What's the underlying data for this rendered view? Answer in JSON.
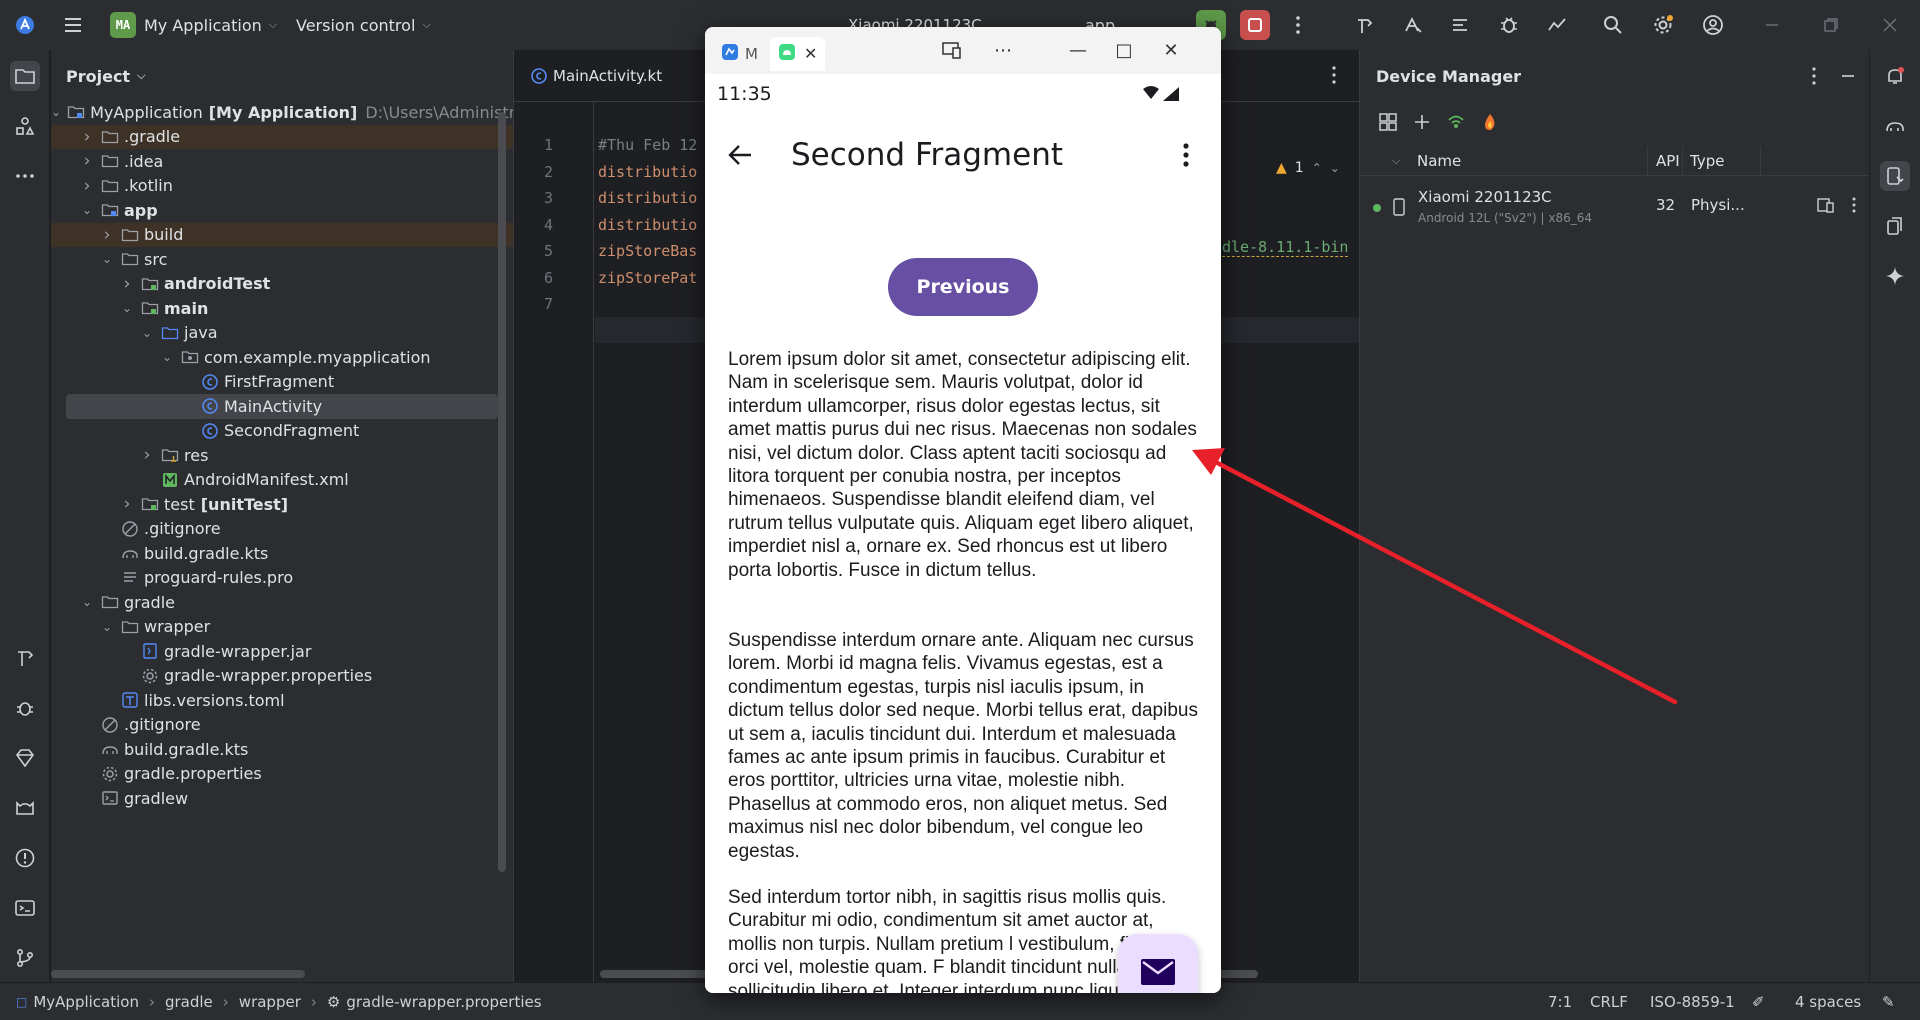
{
  "titlebar": {
    "project_badge": "MA",
    "project_name": "My Application",
    "version_control": "Version control",
    "device_selector": "Xiaomi 2201123C",
    "run_config": "app"
  },
  "project_panel": {
    "title": "Project",
    "tree": [
      {
        "label": "MyApplication",
        "suffix": "[My Application]",
        "path": "D:\\Users\\Administrat",
        "icon": "module-folder-icon",
        "chev": "down",
        "depth": 0
      },
      {
        "label": ".gradle",
        "icon": "folder-icon",
        "chev": "right",
        "depth": 1,
        "orange": true
      },
      {
        "label": ".idea",
        "icon": "folder-icon",
        "chev": "right",
        "depth": 1
      },
      {
        "label": ".kotlin",
        "icon": "folder-icon",
        "chev": "right",
        "depth": 1
      },
      {
        "label": "app",
        "icon": "module-folder-icon",
        "chev": "down",
        "depth": 1,
        "bold": true
      },
      {
        "label": "build",
        "icon": "folder-icon",
        "chev": "right",
        "depth": 2,
        "orange": true
      },
      {
        "label": "src",
        "icon": "folder-icon",
        "chev": "down",
        "depth": 2
      },
      {
        "label": "androidTest",
        "icon": "test-folder-icon",
        "chev": "right",
        "depth": 3,
        "bold": true
      },
      {
        "label": "main",
        "icon": "source-folder-icon",
        "chev": "down",
        "depth": 3,
        "bold": true
      },
      {
        "label": "java",
        "icon": "java-folder-icon",
        "chev": "down",
        "depth": 4
      },
      {
        "label": "com.example.myapplication",
        "icon": "package-icon",
        "chev": "down",
        "depth": 5
      },
      {
        "label": "FirstFragment",
        "icon": "kotlin-class-icon",
        "chev": "",
        "depth": 6
      },
      {
        "label": "MainActivity",
        "icon": "kotlin-class-icon",
        "chev": "",
        "depth": 6,
        "selected": true
      },
      {
        "label": "SecondFragment",
        "icon": "kotlin-class-icon",
        "chev": "",
        "depth": 6
      },
      {
        "label": "res",
        "icon": "resource-folder-icon",
        "chev": "right",
        "depth": 4
      },
      {
        "label": "AndroidManifest.xml",
        "icon": "manifest-icon",
        "chev": "",
        "depth": 4
      },
      {
        "label": "test",
        "suffix": "[unitTest]",
        "icon": "test-folder-icon",
        "chev": "right",
        "depth": 3
      },
      {
        "label": ".gitignore",
        "icon": "ignore-file-icon",
        "chev": "",
        "depth": 2
      },
      {
        "label": "build.gradle.kts",
        "icon": "gradle-icon",
        "chev": "",
        "depth": 2
      },
      {
        "label": "proguard-rules.pro",
        "icon": "text-file-icon",
        "chev": "",
        "depth": 2
      },
      {
        "label": "gradle",
        "icon": "folder-icon",
        "chev": "down",
        "depth": 1
      },
      {
        "label": "wrapper",
        "icon": "folder-icon",
        "chev": "down",
        "depth": 2
      },
      {
        "label": "gradle-wrapper.jar",
        "icon": "jar-icon",
        "chev": "",
        "depth": 3
      },
      {
        "label": "gradle-wrapper.properties",
        "icon": "settings-file-icon",
        "chev": "",
        "depth": 3
      },
      {
        "label": "libs.versions.toml",
        "icon": "toml-icon",
        "chev": "",
        "depth": 2
      },
      {
        "label": ".gitignore",
        "icon": "ignore-file-icon",
        "chev": "",
        "depth": 1
      },
      {
        "label": "build.gradle.kts",
        "icon": "gradle-icon",
        "chev": "",
        "depth": 1
      },
      {
        "label": "gradle.properties",
        "icon": "settings-file-icon",
        "chev": "",
        "depth": 1
      },
      {
        "label": "gradlew",
        "icon": "terminal-file-icon",
        "chev": "",
        "depth": 1
      }
    ]
  },
  "editor": {
    "tab_label": "MainActivity.kt",
    "line_numbers": [
      "1",
      "2",
      "3",
      "4",
      "5",
      "6",
      "7"
    ],
    "code_lines": [
      "#Thu Feb 12",
      "distributio",
      "distributio",
      "distributio",
      "zipStoreBas",
      "zipStorePat",
      ""
    ],
    "code_right": "dle-8.11.1-bin",
    "warning_count": "1"
  },
  "device_manager": {
    "title": "Device Manager",
    "columns": {
      "name": "Name",
      "api": "API",
      "type": "Type"
    },
    "device": {
      "name": "Xiaomi 2201123C",
      "subtitle": "Android 12L (\"Sv2\") | x86_64",
      "api": "32",
      "type": "Physi..."
    }
  },
  "statusbar": {
    "breadcrumb": [
      "MyApplication",
      "gradle",
      "wrapper",
      "gradle-wrapper.properties"
    ],
    "position": "7:1",
    "line_sep": "CRLF",
    "encoding": "ISO-8859-1",
    "indent": "4 spaces"
  },
  "emulator": {
    "tab1": "M",
    "phone": {
      "time": "11:35",
      "title": "Second Fragment",
      "previous_button": "Previous",
      "paragraphs": [
        "Lorem ipsum dolor sit amet, consectetur adipiscing elit. Nam in scelerisque sem. Mauris volutpat, dolor id interdum ullamcorper, risus dolor egestas lectus, sit amet mattis purus dui nec risus. Maecenas non sodales nisi, vel dictum dolor. Class aptent taciti sociosqu ad litora torquent per conubia nostra, per inceptos himenaeos. Suspendisse blandit eleifend diam, vel rutrum tellus vulputate quis. Aliquam eget libero aliquet, imperdiet nisl a, ornare ex. Sed rhoncus est ut libero porta lobortis. Fusce in dictum tellus.",
        " Suspendisse interdum ornare ante. Aliquam nec cursus lorem. Morbi id magna felis. Vivamus egestas, est a condimentum egestas, turpis nisl iaculis ipsum, in dictum tellus dolor sed neque. Morbi tellus erat, dapibus ut sem a, iaculis tincidunt dui. Interdum et malesuada fames ac ante ipsum primis in faucibus. Curabitur et eros porttitor, ultricies urna vitae, molestie nibh. Phasellus at commodo eros, non aliquet metus. Sed maximus nisl nec dolor bibendum, vel congue leo egestas.",
        " Sed interdum tortor nibh, in sagittis risus mollis quis. Curabitur mi odio, condimentum sit amet auctor at, mollis non turpis. Nullam pretium l vestibulum, finibus orci vel, molestie quam. F blandit tincidunt nulla, quis sollicitudin libero et. Integer interdum nunc ligula, et fermentum metus"
      ]
    }
  },
  "colors": {
    "accent_button": "#6750a4",
    "fab_bg": "#eaddff",
    "annotation_arrow": "#e8202a",
    "device_online": "#5fb85f"
  }
}
